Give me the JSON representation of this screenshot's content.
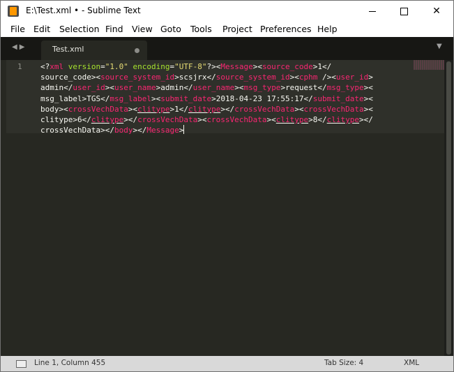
{
  "window": {
    "title": "E:\\Test.xml • - Sublime Text"
  },
  "menu": [
    "File",
    "Edit",
    "Selection",
    "Find",
    "View",
    "Goto",
    "Tools",
    "Project",
    "Preferences",
    "Help"
  ],
  "tab": {
    "label": "Test.xml"
  },
  "editor": {
    "line_number": "1",
    "code_lines": [
      "<?xml version=\"1.0\" encoding=\"UTF-8\"?><Message><source_code>1</",
      "source_code><source_system_id>scsjrx</source_system_id><cphm /><user_id>",
      "admin</user_id><user_name>admin</user_name><msg_type>request</msg_type><",
      "msg_label>TGS</msg_label><submit_date>2018-04-23 17:55:17</submit_date><",
      "body><crossVechData><clitype>1</clitype></crossVechData><crossVechData><",
      "clitype>6</clitype></crossVechData><crossVechData><clitype>8</clitype></",
      "crossVechData></body></Message>"
    ]
  },
  "status": {
    "position": "Line 1, Column 455",
    "tab_size": "Tab Size: 4",
    "syntax": "XML"
  },
  "colors": {
    "background": "#272822",
    "tag": "#f92672",
    "attribute": "#a6e22e",
    "string": "#e6db74",
    "text": "#f8f8f2",
    "tabbar": "#171714",
    "statusbar": "#d9d9d9"
  },
  "icons": {
    "app": "sublime-text-logo-icon",
    "nav": "nav-arrows-icon",
    "modified": "modified-dot-icon",
    "tab_dropdown": "tab-dropdown-icon",
    "panel": "panel-switcher-icon"
  }
}
